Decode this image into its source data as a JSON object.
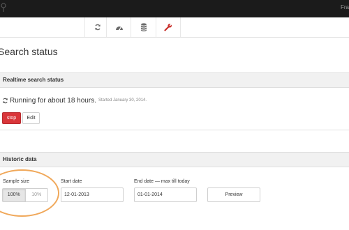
{
  "topbar": {
    "user_name": "Fra",
    "logo_icon": "logo-icon"
  },
  "toolbar": {
    "buttons": [
      {
        "icon": "refresh-icon",
        "color": "#6b6b6b"
      },
      {
        "icon": "dashboard-icon",
        "color": "#6b6b6b"
      },
      {
        "icon": "database-icon",
        "color": "#6b6b6b"
      },
      {
        "icon": "wrench-icon",
        "color": "#c9302c"
      }
    ]
  },
  "page": {
    "title": "Search status"
  },
  "realtime": {
    "heading": "Realtime search status",
    "status_icon": "refresh-icon",
    "status_text": "Running for about 18 hours.",
    "started_text": "Started January 30, 2014.",
    "stop_label": "stop",
    "edit_label": "Edit"
  },
  "historic": {
    "heading": "Historic data",
    "sample_size_label": "Sample size",
    "sample_options": [
      "100%",
      "10%"
    ],
    "sample_selected": "100%",
    "start_date_label": "Start date",
    "start_date_value": "12-01-2013",
    "end_date_label": "End date — max till today",
    "end_date_value": "01-01-2014",
    "preview_label": "Preview"
  },
  "colors": {
    "danger": "#d9363a",
    "highlight": "#f0a85a",
    "topbar": "#1b1b1b"
  }
}
